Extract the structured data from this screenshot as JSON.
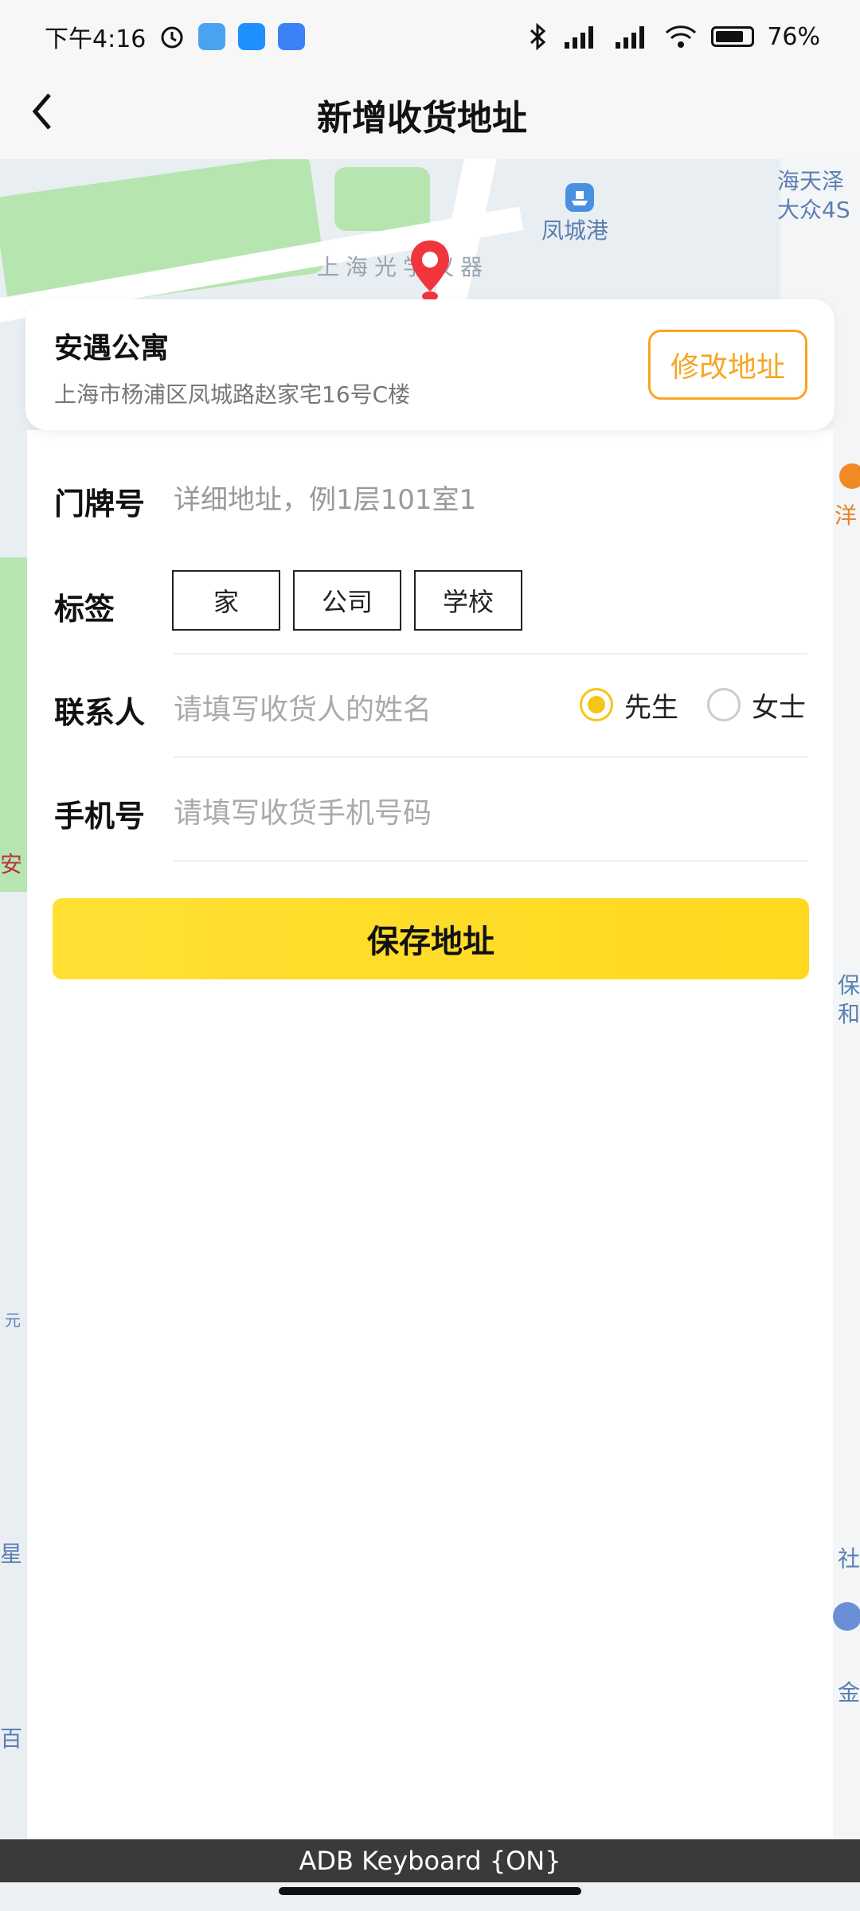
{
  "status_bar": {
    "time": "下午4:16",
    "battery": "76%"
  },
  "nav": {
    "title": "新增收货地址"
  },
  "map": {
    "labels": {
      "top_right_1": "海天泽",
      "top_right_2": "大众4S",
      "harbor": "凤城港",
      "building": "上海光学仪器",
      "side_1": "洋",
      "side_2": "安",
      "side_3": "保",
      "side_4": "和",
      "side_5": "元",
      "side_6": "星",
      "side_7": "百",
      "side_8": "金",
      "side_9": "社"
    }
  },
  "location_card": {
    "name": "安遇公寓",
    "address": "上海市杨浦区凤城路赵家宅16号C楼",
    "modify_label": "修改地址"
  },
  "form": {
    "house_label": "门牌号",
    "house_placeholder": "详细地址，例1层101室1",
    "tag_label": "标签",
    "tags": [
      "家",
      "公司",
      "学校"
    ],
    "contact_label": "联系人",
    "contact_placeholder": "请填写收货人的姓名",
    "gender_male": "先生",
    "gender_female": "女士",
    "gender_selected": "先生",
    "phone_label": "手机号",
    "phone_placeholder": "请填写收货手机号码",
    "save_label": "保存地址"
  },
  "keyboard_bar": {
    "text": "ADB Keyboard {ON}"
  },
  "colors": {
    "accent": "#f5a623",
    "primary_button": "#ffd91f",
    "radio_on": "#f5c518"
  }
}
